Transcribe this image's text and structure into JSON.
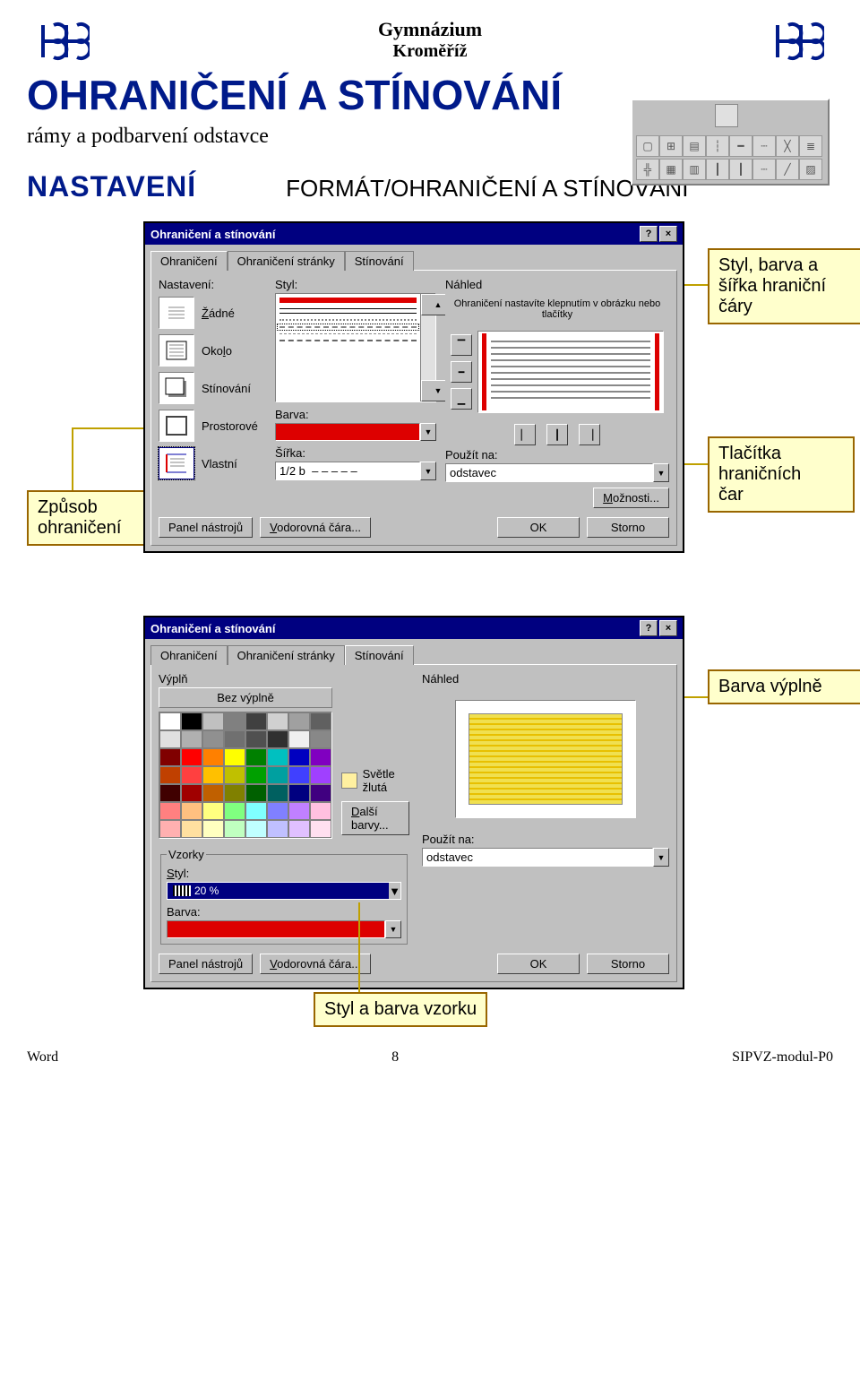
{
  "header": {
    "line1": "Gymnázium",
    "line2": "Kroměříž"
  },
  "title": "OHRANIČENÍ A STÍNOVÁNÍ",
  "subtitle": "rámy a podbarvení odstavce",
  "nastaveni": "NASTAVENÍ",
  "format": "FORMÁT/OHRANIČENÍ A STÍNOVÁNÍ",
  "d1": {
    "title": "Ohraničení a stínování",
    "tabs": [
      "Ohraničení",
      "Ohraničení stránky",
      "Stínování"
    ],
    "activeTab": 0,
    "nastaveniLabel": "Nastavení:",
    "options": [
      {
        "label": "Žádné"
      },
      {
        "label": "Okolo"
      },
      {
        "label": "Stínování"
      },
      {
        "label": "Prostorové"
      },
      {
        "label": "Vlastní"
      }
    ],
    "stylLabel": "Styl:",
    "barvaLabel": "Barva:",
    "sirkaLabel": "Šířka:",
    "sirkaValue": "1/2 b",
    "nahledLabel": "Náhled",
    "nahledHint": "Ohraničení nastavíte klepnutím v obrázku nebo tlačítky",
    "pouzitNaLabel": "Použít na:",
    "pouzitNaValue": "odstavec",
    "moznosti": "Možnosti...",
    "panel": "Panel nástrojů",
    "vodorovna": "Vodorovná čára...",
    "ok": "OK",
    "storno": "Storno"
  },
  "d2": {
    "title": "Ohraničení a stínování",
    "tabs": [
      "Ohraničení",
      "Ohraničení stránky",
      "Stínování"
    ],
    "activeTab": 2,
    "vyplnLabel": "Výplň",
    "bezVyplne": "Bez výplně",
    "svetleZluta": "Světle žlutá",
    "dalsiBarvy": "Další barvy...",
    "vzorkyLabel": "Vzorky",
    "stylLabel": "Styl:",
    "stylValue": "20 %",
    "barvaLabel": "Barva:",
    "nahledLabel": "Náhled",
    "pouzitNaLabel": "Použít na:",
    "pouzitNaValue": "odstavec",
    "panel": "Panel nástrojů",
    "vodorovna": "Vodorovná čára...",
    "ok": "OK",
    "storno": "Storno"
  },
  "callouts": {
    "c1": "Styl, barva a\nšířka hraniční\nčáry",
    "c2": "Způsob\nohraničení",
    "c3": "Tlačítka\nhraničních\nčar",
    "c4": "Barva výplně",
    "c5": "Styl a barva vzorku"
  },
  "footer": {
    "left": "Word",
    "mid": "8",
    "right": "SIPVZ-modul-P0"
  },
  "paletteColors": [
    "#ffffff",
    "#000000",
    "#c0c0c0",
    "#808080",
    "#404040",
    "#d0d0d0",
    "#a0a0a0",
    "#606060",
    "#e0e0e0",
    "#b0b0b0",
    "#909090",
    "#707070",
    "#505050",
    "#303030",
    "#f0f0f0",
    "#888888",
    "#800000",
    "#ff0000",
    "#ff8000",
    "#ffff00",
    "#008000",
    "#00c0c0",
    "#0000c0",
    "#8000c0",
    "#c04000",
    "#ff4040",
    "#ffc000",
    "#c0c000",
    "#00a000",
    "#00a0a0",
    "#4040ff",
    "#a040ff",
    "#400000",
    "#a00000",
    "#c06000",
    "#808000",
    "#006000",
    "#006060",
    "#000080",
    "#400080",
    "#ff8080",
    "#ffc080",
    "#ffff80",
    "#80ff80",
    "#80ffff",
    "#8080ff",
    "#c080ff",
    "#ffc0e0",
    "#ffb0b0",
    "#ffe0a0",
    "#ffffc0",
    "#c0ffc0",
    "#c0ffff",
    "#c0c0ff",
    "#e0c0ff",
    "#ffe0f0"
  ]
}
